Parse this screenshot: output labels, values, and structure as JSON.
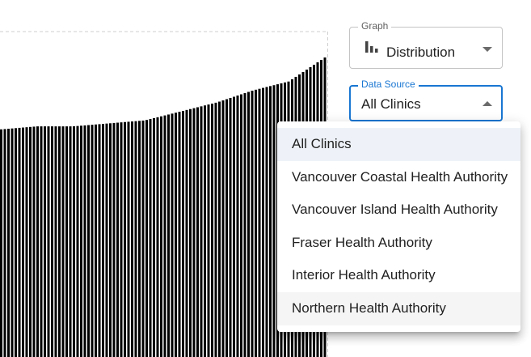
{
  "graph_select": {
    "label": "Graph",
    "value": "Distribution",
    "icon": "bar-chart-icon"
  },
  "data_source_select": {
    "label": "Data Source",
    "value": "All Clinics",
    "accent_color": "#1976d2",
    "expanded": true,
    "options": [
      "All Clinics",
      "Vancouver Coastal Health Authority",
      "Vancouver Island Health Authority",
      "Fraser Health Authority",
      "Interior Health Authority",
      "Northern Health Authority"
    ],
    "selected_index": 0,
    "hovered_index": 5
  },
  "chart_data": {
    "type": "bar",
    "bar_color": "#000000",
    "grid": false,
    "bar_count": 90,
    "relative_values": [
      0.76,
      0.77,
      0.77,
      0.78,
      0.79,
      0.82,
      0.85,
      0.89,
      0.92,
      1.0
    ]
  }
}
